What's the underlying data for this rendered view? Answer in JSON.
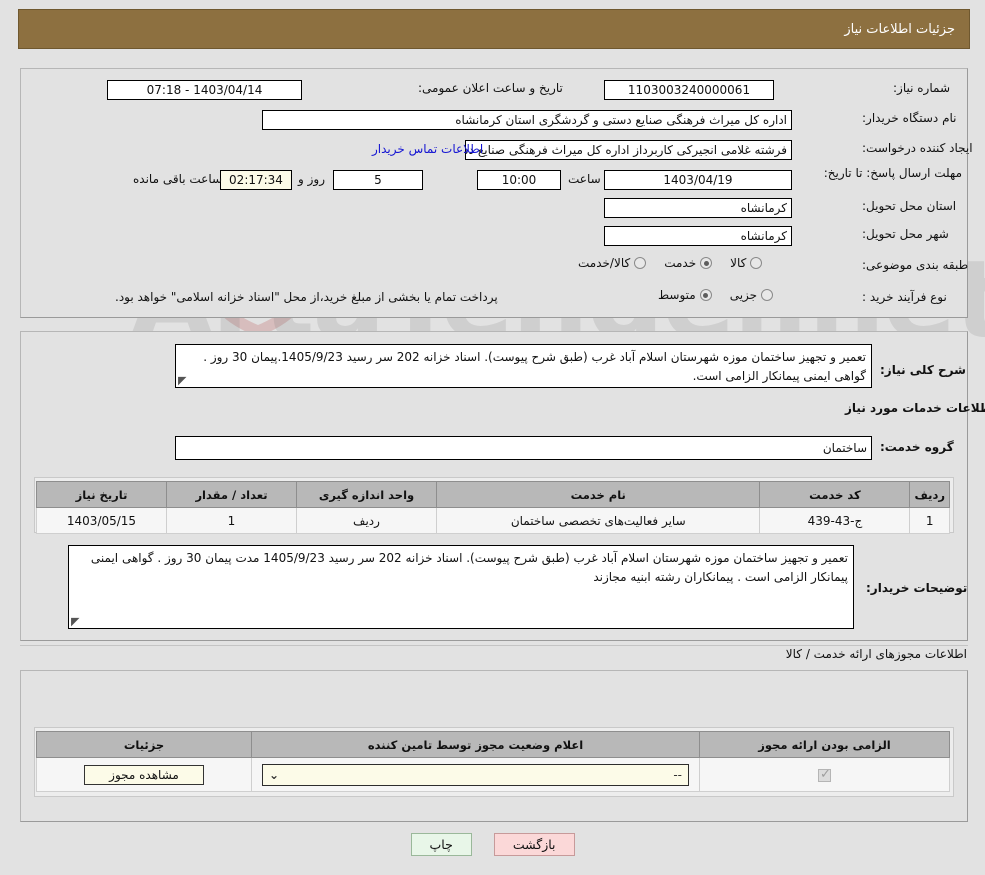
{
  "window": {
    "title": "جزئیات اطلاعات نیاز"
  },
  "colors": {
    "header_bar": "#8d7040",
    "page_background": "#e2e2e2",
    "table_header": "#b8b8b8",
    "link": "#1414d2",
    "field_highlight": "#fcfbe8",
    "print_button": "#e8f6e8",
    "back_button": "#fbd8d8"
  },
  "watermark": {
    "text": "ArtaTender.net"
  },
  "info": {
    "need_number_label": "شماره نیاز:",
    "need_number_value": "1103003240000061",
    "public_announce_label": "تاریخ و ساعت اعلان عمومی:",
    "public_announce_value": "1403/04/14 - 07:18",
    "buyer_org_label": "نام دستگاه خریدار:",
    "buyer_org_value": "اداره کل میراث فرهنگی  صنایع دستی و گردشگری استان کرمانشاه",
    "requester_label": "ایجاد کننده درخواست:",
    "requester_value": "فرشته غلامی انجیرکی کاربرداز اداره کل میراث فرهنگی  صنایع دستی و گردشگ",
    "buyer_contact_link": "اطلاعات تماس خریدار",
    "deadline_label": "مهلت ارسال پاسخ: تا تاریخ:",
    "deadline_date": "1403/04/19",
    "deadline_time_label": "ساعت",
    "deadline_time": "10:00",
    "days_remaining": "5",
    "days_unit_label": "روز و",
    "hours_remaining": "02:17:34",
    "remaining_suffix_label": "ساعت باقی مانده",
    "delivery_province_label": "استان محل تحویل:",
    "delivery_province_value": "کرمانشاه",
    "delivery_city_label": "شهر محل تحویل:",
    "delivery_city_value": "کرمانشاه",
    "category_label": "طبقه بندی موضوعی:",
    "category_options": [
      {
        "label": "کالا",
        "selected": false
      },
      {
        "label": "خدمت",
        "selected": true
      },
      {
        "label": "کالا/خدمت",
        "selected": false
      }
    ],
    "purchase_type_label": "نوع فرآیند خرید :",
    "purchase_type_options": [
      {
        "label": "جزیی",
        "selected": false
      },
      {
        "label": "متوسط",
        "selected": true
      }
    ],
    "purchase_note": "پرداخت تمام یا بخشی از مبلغ خرید،از محل \"اسناد خزانه اسلامی\" خواهد بود."
  },
  "description": {
    "general_label": "شرح کلی نیاز:",
    "general_value": "تعمیر و تجهیز ساختمان موزه شهرستان اسلام آباد غرب (طبق شرح پیوست). اسناد خزانه  202 سر رسید 1405/9/23.پیمان 30 روز . گواهی ایمنی پیمانکار الزامی است.",
    "services_section_title": "اطلاعات خدمات مورد نیاز",
    "service_group_label": "گروه خدمت:",
    "service_group_value": "ساختمان",
    "buyer_notes_label": "توضیحات خریدار:",
    "buyer_notes_value": "تعمیر و تجهیز ساختمان موزه شهرستان اسلام آباد غرب (طبق شرح پیوست). اسناد خزانه  202 سر رسید 1405/9/23  مدت پیمان 30 روز . گواهی ایمنی پیمانکار الزامی است . پیمانکاران رشته ابنیه مجازند"
  },
  "services_table": {
    "headers": [
      "ردیف",
      "کد خدمت",
      "نام خدمت",
      "واحد اندازه گیری",
      "تعداد / مقدار",
      "تاریخ نیاز"
    ],
    "rows": [
      {
        "index": "1",
        "code": "ج-43-439",
        "name": "سایر فعالیت‌های تخصصی ساختمان",
        "unit": "ردیف",
        "quantity": "1",
        "need_date": "1403/05/15"
      }
    ]
  },
  "licenses": {
    "section_title": "اطلاعات مجوزهای ارائه خدمت / کالا",
    "headers": [
      "الزامی بودن ارائه مجوز",
      "اعلام وضعیت مجوز توسط تامین کننده",
      "جزئیات"
    ],
    "rows": [
      {
        "required": true,
        "status_value": "--",
        "details_button": "مشاهده مجوز"
      }
    ]
  },
  "footer": {
    "print_label": "چاپ",
    "back_label": "بازگشت"
  }
}
